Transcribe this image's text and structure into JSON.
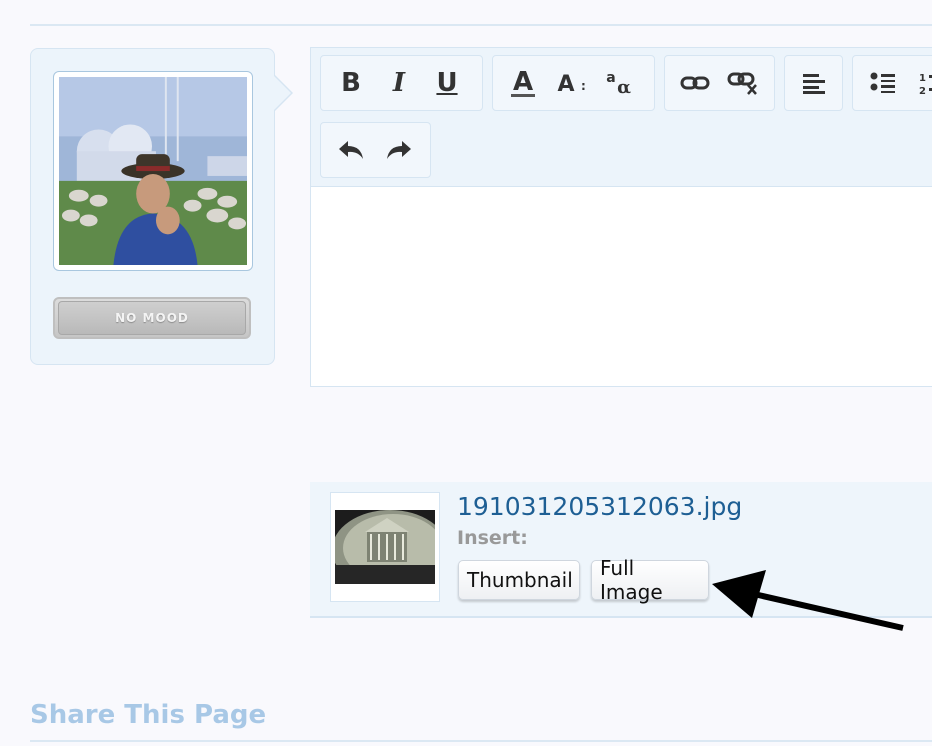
{
  "user_panel": {
    "mood_label": "NO MOOD"
  },
  "editor": {
    "toolbar": {
      "groups": [
        {
          "name": "text-style",
          "buttons": [
            {
              "icon": "bold-icon",
              "glyph": "B"
            },
            {
              "icon": "italic-icon",
              "glyph": "I"
            },
            {
              "icon": "underline-icon",
              "glyph": "U"
            }
          ]
        },
        {
          "name": "font",
          "buttons": [
            {
              "icon": "font-color-icon",
              "glyph": "A"
            },
            {
              "icon": "font-size-icon",
              "glyph": "A:"
            },
            {
              "icon": "font-family-icon",
              "glyph": "a"
            }
          ]
        },
        {
          "name": "links",
          "buttons": [
            {
              "icon": "link-icon"
            },
            {
              "icon": "unlink-icon"
            }
          ]
        },
        {
          "name": "align",
          "buttons": [
            {
              "icon": "align-left-icon"
            }
          ]
        },
        {
          "name": "lists",
          "buttons": [
            {
              "icon": "bullet-list-icon"
            },
            {
              "icon": "numbered-list-icon"
            }
          ]
        },
        {
          "name": "history",
          "buttons": [
            {
              "icon": "undo-icon"
            },
            {
              "icon": "redo-icon"
            }
          ]
        }
      ]
    },
    "content": ""
  },
  "attachment": {
    "filename": "191031205312063.jpg",
    "insert_label": "Insert:",
    "thumbnail_button": "Thumbnail",
    "full_image_button": "Full Image"
  },
  "share": {
    "heading": "Share This Page"
  },
  "colors": {
    "panel_bg": "#ecf4fb",
    "border": "#d6e5f2",
    "link": "#1e5f94",
    "heading": "#a8c8e6"
  }
}
